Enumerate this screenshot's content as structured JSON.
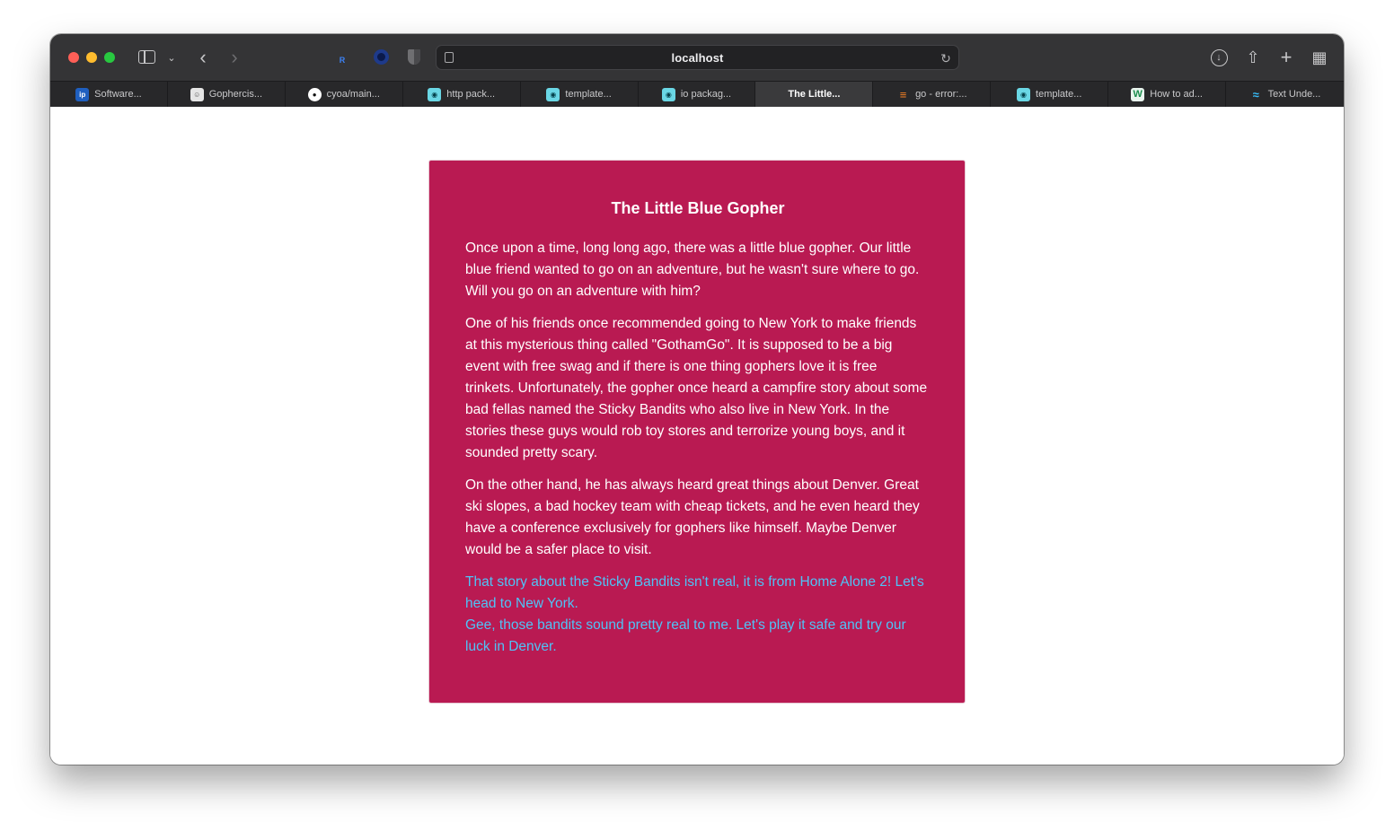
{
  "browser": {
    "address": "localhost",
    "tabs": [
      {
        "label": "Software...",
        "icon": "ip-logo-icon",
        "active": false
      },
      {
        "label": "Gophercis...",
        "icon": "gopher-icon",
        "active": false
      },
      {
        "label": "cyoa/main...",
        "icon": "github-icon",
        "active": false
      },
      {
        "label": "http pack...",
        "icon": "go-gopher-icon",
        "active": false
      },
      {
        "label": "template...",
        "icon": "go-gopher-icon",
        "active": false
      },
      {
        "label": "io packag...",
        "icon": "go-gopher-icon",
        "active": false
      },
      {
        "label": "The Little...",
        "icon": "none",
        "active": true
      },
      {
        "label": "go - error:...",
        "icon": "stackoverflow-icon",
        "active": false
      },
      {
        "label": "template...",
        "icon": "go-gopher-icon",
        "active": false
      },
      {
        "label": "How to ad...",
        "icon": "w-logo-icon",
        "active": false
      },
      {
        "label": "Text Unde...",
        "icon": "tailwind-icon",
        "active": false
      }
    ]
  },
  "story": {
    "title": "The Little Blue Gopher",
    "paragraphs": [
      "Once upon a time, long long ago, there was a little blue gopher. Our little blue friend wanted to go on an adventure, but he wasn't sure where to go. Will you go on an adventure with him?",
      "One of his friends once recommended going to New York to make friends at this mysterious thing called \"GothamGo\". It is supposed to be a big event with free swag and if there is one thing gophers love it is free trinkets. Unfortunately, the gopher once heard a campfire story about some bad fellas named the Sticky Bandits who also live in New York. In the stories these guys would rob toy stores and terrorize young boys, and it sounded pretty scary.",
      "On the other hand, he has always heard great things about Denver. Great ski slopes, a bad hockey team with cheap tickets, and he even heard they have a conference exclusively for gophers like himself. Maybe Denver would be a safer place to visit."
    ],
    "options": [
      "That story about the Sticky Bandits isn't real, it is from Home Alone 2! Let's head to New York.",
      "Gee, those bandits sound pretty real to me. Let's play it safe and try our luck in Denver."
    ]
  },
  "colors": {
    "card_background": "#b91a52",
    "link": "#4fc3f7",
    "toolbar": "#343436"
  }
}
